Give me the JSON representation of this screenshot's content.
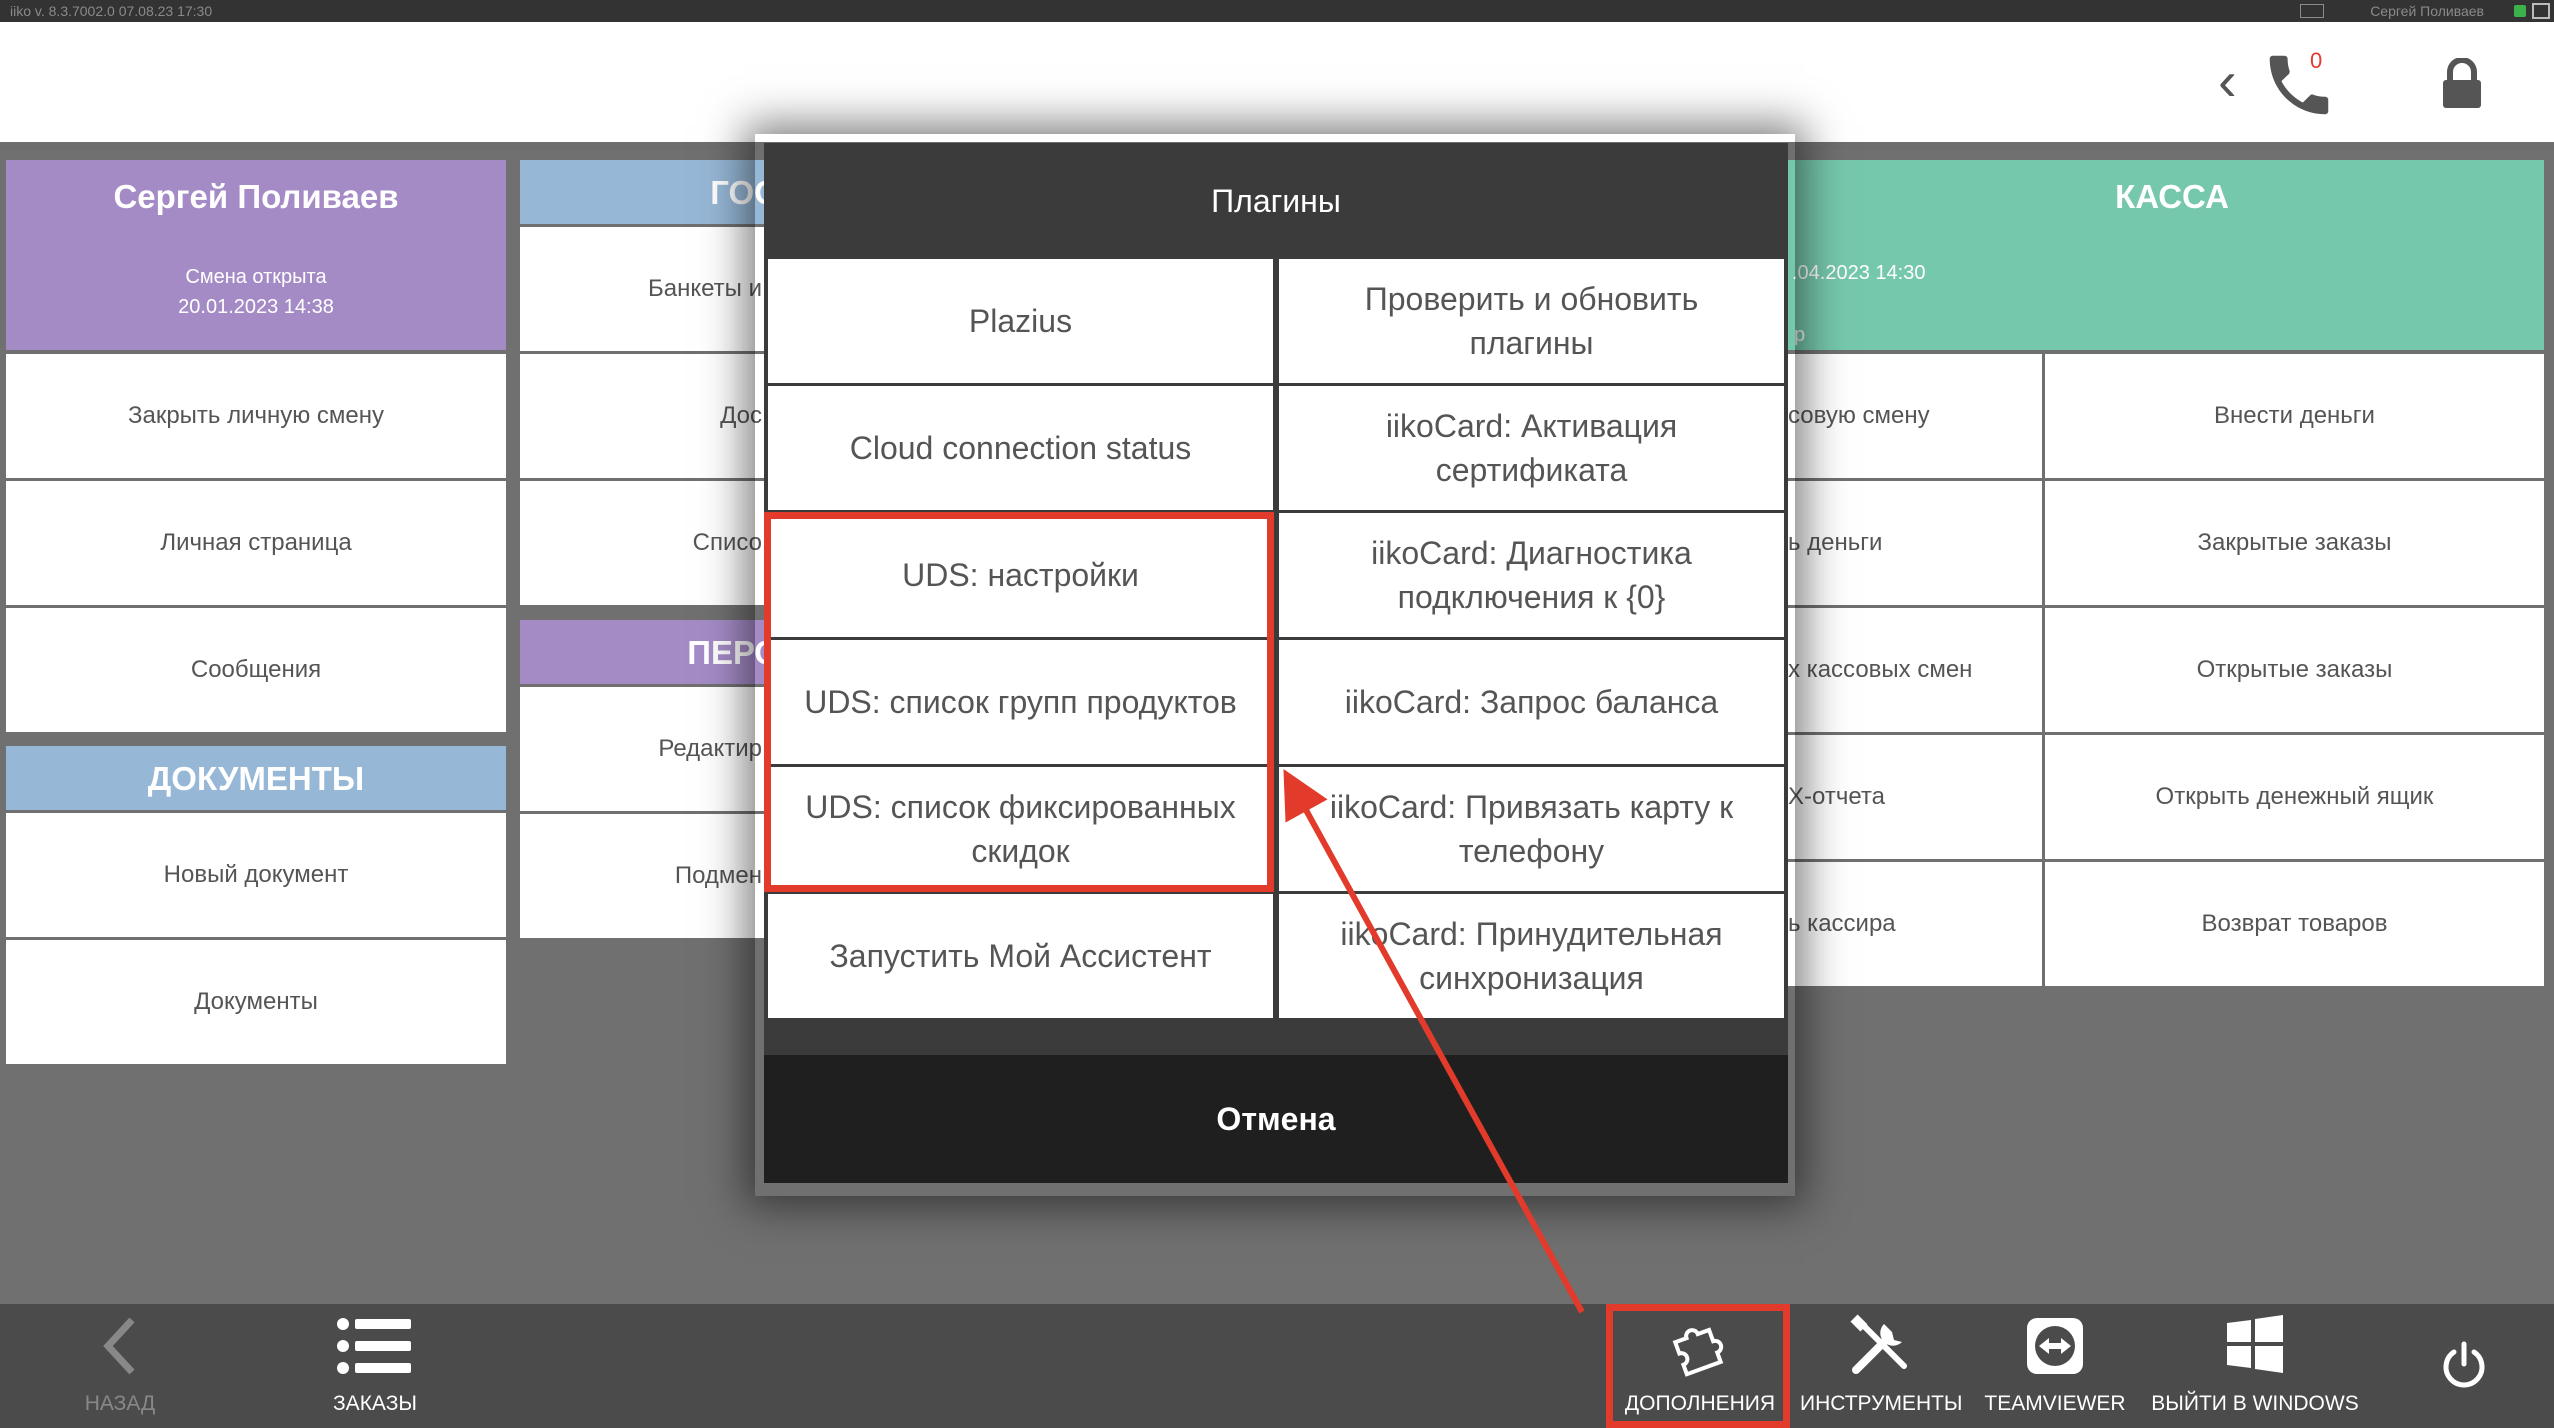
{
  "status_bar": {
    "left_text": "iiko v. 8.3.7002.0     07.08.23   17:30",
    "right_text": "Сергей Поливаев"
  },
  "header": {
    "missed_calls": "0"
  },
  "personal": {
    "title": "Сергей Поливаев",
    "subtitle_line1": "Смена открыта",
    "subtitle_line2": "20.01.2023 14:38",
    "items": [
      "Закрыть личную смену",
      "Личная страница",
      "Сообщения"
    ]
  },
  "documents": {
    "title": "ДОКУМЕНТЫ",
    "items": [
      "Новый документ",
      "Документы"
    ]
  },
  "guests": {
    "title": "ГОС",
    "items": [
      "Банкеты и",
      "Дос",
      "Списо"
    ]
  },
  "personnel": {
    "title": "ПЕРС",
    "items": [
      "Редактир",
      "Подмен"
    ]
  },
  "kassa": {
    "title": "КАССА",
    "date_fragment": ".04.2023 14:30",
    "sub_fragment": "р",
    "left_items": [
      "совую смену",
      "ь деньги",
      "х кассовых смен",
      "Х-отчета",
      "ь кассира"
    ],
    "right_items": [
      "Внести деньги",
      "Закрытые заказы",
      "Открытые заказы",
      "Открыть денежный ящик",
      "Возврат товаров"
    ]
  },
  "modal": {
    "title": "Плагины",
    "options": [
      "Plazius",
      "Проверить и обновить плагины",
      "Cloud connection status",
      "iikoCard: Активация сертификата",
      "UDS: настройки",
      "iikoCard: Диагностика подключения к {0}",
      "UDS: список групп продуктов",
      "iikoCard: Запрос баланса",
      "UDS: список фиксированных скидок",
      "iikoCard: Привязать карту к телефону",
      "Запустить Мой Ассистент",
      "iikoCard: Принудительная синхронизация"
    ],
    "cancel_label": "Отмена"
  },
  "bottom_bar": {
    "back_label": "НАЗАД",
    "orders_label": "ЗАКАЗЫ",
    "addons_label": "ДОПОЛНЕНИЯ",
    "tools_label": "ИНСТРУМЕНТЫ",
    "teamviewer_label": "TEAMVIEWER",
    "exit_windows_label": "ВЫЙТИ В WINDOWS"
  },
  "colors": {
    "accent_red": "#e23b2c",
    "purple": "#a48bc6",
    "blue": "#96b7d6",
    "teal": "#76c8ac"
  }
}
